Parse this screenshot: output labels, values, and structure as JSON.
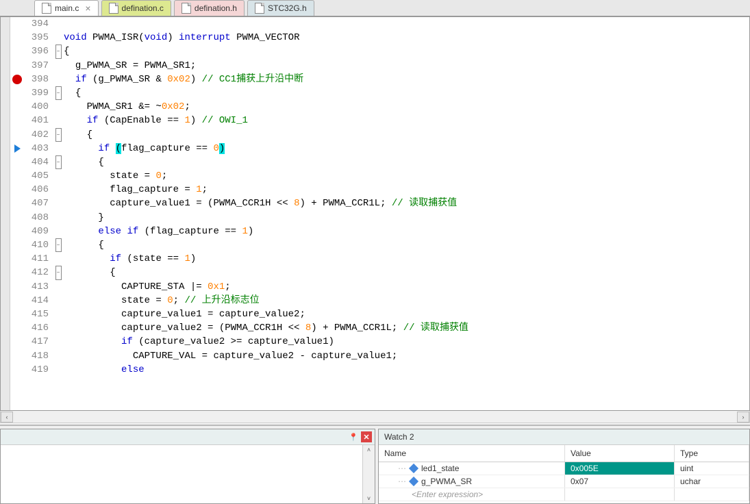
{
  "tabs": [
    {
      "label": "main.c",
      "style": "active",
      "closable": true
    },
    {
      "label": "defination.c",
      "style": "yellow",
      "closable": false
    },
    {
      "label": "defination.h",
      "style": "pink",
      "closable": false
    },
    {
      "label": "STC32G.h",
      "style": "gray",
      "closable": false
    }
  ],
  "line_numbers": [
    "394",
    "395",
    "396",
    "397",
    "398",
    "399",
    "400",
    "401",
    "402",
    "403",
    "404",
    "405",
    "406",
    "407",
    "408",
    "409",
    "410",
    "411",
    "412",
    "413",
    "414",
    "415",
    "416",
    "417",
    "418",
    "419"
  ],
  "markers": {
    "398": "breakpoint",
    "403": "cursor"
  },
  "fold": {
    "396": "minus",
    "399": "minus",
    "402": "minus",
    "404": "minus",
    "410": "minus",
    "412": "minus"
  },
  "code": [
    {
      "indent": 0,
      "parts": [
        {
          "t": "",
          "c": ""
        }
      ]
    },
    {
      "indent": 0,
      "parts": [
        {
          "t": "void",
          "c": "kw"
        },
        {
          "t": " PWMA_ISR(",
          "c": ""
        },
        {
          "t": "void",
          "c": "kw"
        },
        {
          "t": ") ",
          "c": ""
        },
        {
          "t": "interrupt",
          "c": "kw"
        },
        {
          "t": " PWMA_VECTOR",
          "c": ""
        }
      ]
    },
    {
      "indent": 0,
      "parts": [
        {
          "t": "{",
          "c": ""
        }
      ]
    },
    {
      "indent": 1,
      "parts": [
        {
          "t": "g_PWMA_SR = PWMA_SR1;",
          "c": ""
        }
      ]
    },
    {
      "indent": 1,
      "parts": [
        {
          "t": "if",
          "c": "kw"
        },
        {
          "t": " (g_PWMA_SR & ",
          "c": ""
        },
        {
          "t": "0x02",
          "c": "num"
        },
        {
          "t": ") ",
          "c": ""
        },
        {
          "t": "// CC1捕获上升沿中断",
          "c": "com"
        }
      ]
    },
    {
      "indent": 1,
      "parts": [
        {
          "t": "{",
          "c": ""
        }
      ]
    },
    {
      "indent": 2,
      "parts": [
        {
          "t": "PWMA_SR1 &= ~",
          "c": ""
        },
        {
          "t": "0x02",
          "c": "num"
        },
        {
          "t": ";",
          "c": ""
        }
      ]
    },
    {
      "indent": 2,
      "parts": [
        {
          "t": "if",
          "c": "kw"
        },
        {
          "t": " (CapEnable == ",
          "c": ""
        },
        {
          "t": "1",
          "c": "num"
        },
        {
          "t": ") ",
          "c": ""
        },
        {
          "t": "// OWI_1",
          "c": "com"
        }
      ]
    },
    {
      "indent": 2,
      "parts": [
        {
          "t": "{",
          "c": ""
        }
      ]
    },
    {
      "indent": 3,
      "parts": [
        {
          "t": "if",
          "c": "kw"
        },
        {
          "t": " ",
          "c": ""
        },
        {
          "t": "(",
          "c": "hl"
        },
        {
          "t": "flag_capture == ",
          "c": ""
        },
        {
          "t": "0",
          "c": "num"
        },
        {
          "t": ")",
          "c": "hl"
        }
      ]
    },
    {
      "indent": 3,
      "parts": [
        {
          "t": "{",
          "c": ""
        }
      ]
    },
    {
      "indent": 4,
      "parts": [
        {
          "t": "state = ",
          "c": ""
        },
        {
          "t": "0",
          "c": "num"
        },
        {
          "t": ";",
          "c": ""
        }
      ]
    },
    {
      "indent": 4,
      "parts": [
        {
          "t": "flag_capture = ",
          "c": ""
        },
        {
          "t": "1",
          "c": "num"
        },
        {
          "t": ";",
          "c": ""
        }
      ]
    },
    {
      "indent": 4,
      "parts": [
        {
          "t": "capture_value1 = (PWMA_CCR1H << ",
          "c": ""
        },
        {
          "t": "8",
          "c": "num"
        },
        {
          "t": ") + PWMA_CCR1L; ",
          "c": ""
        },
        {
          "t": "// 读取捕获值",
          "c": "com"
        }
      ]
    },
    {
      "indent": 3,
      "parts": [
        {
          "t": "}",
          "c": ""
        }
      ]
    },
    {
      "indent": 3,
      "parts": [
        {
          "t": "else",
          "c": "kw"
        },
        {
          "t": " ",
          "c": ""
        },
        {
          "t": "if",
          "c": "kw"
        },
        {
          "t": " (flag_capture == ",
          "c": ""
        },
        {
          "t": "1",
          "c": "num"
        },
        {
          "t": ")",
          "c": ""
        }
      ]
    },
    {
      "indent": 3,
      "parts": [
        {
          "t": "{",
          "c": ""
        }
      ]
    },
    {
      "indent": 4,
      "parts": [
        {
          "t": "if",
          "c": "kw"
        },
        {
          "t": " (state == ",
          "c": ""
        },
        {
          "t": "1",
          "c": "num"
        },
        {
          "t": ")",
          "c": ""
        }
      ]
    },
    {
      "indent": 4,
      "parts": [
        {
          "t": "{",
          "c": ""
        }
      ]
    },
    {
      "indent": 5,
      "parts": [
        {
          "t": "CAPTURE_STA |= ",
          "c": ""
        },
        {
          "t": "0x1",
          "c": "num"
        },
        {
          "t": ";",
          "c": ""
        }
      ]
    },
    {
      "indent": 5,
      "parts": [
        {
          "t": "state = ",
          "c": ""
        },
        {
          "t": "0",
          "c": "num"
        },
        {
          "t": "; ",
          "c": ""
        },
        {
          "t": "// 上升沿标志位",
          "c": "com"
        }
      ]
    },
    {
      "indent": 5,
      "parts": [
        {
          "t": "capture_value1 = capture_value2;",
          "c": ""
        }
      ]
    },
    {
      "indent": 5,
      "parts": [
        {
          "t": "capture_value2 = (PWMA_CCR1H << ",
          "c": ""
        },
        {
          "t": "8",
          "c": "num"
        },
        {
          "t": ") + PWMA_CCR1L; ",
          "c": ""
        },
        {
          "t": "// 读取捕获值",
          "c": "com"
        }
      ]
    },
    {
      "indent": 5,
      "parts": [
        {
          "t": "if",
          "c": "kw"
        },
        {
          "t": " (capture_value2 >= capture_value1)",
          "c": ""
        }
      ]
    },
    {
      "indent": 6,
      "parts": [
        {
          "t": "CAPTURE_VAL = capture_value2 - capture_value1;",
          "c": ""
        }
      ]
    },
    {
      "indent": 5,
      "parts": [
        {
          "t": "else",
          "c": "kw"
        }
      ]
    }
  ],
  "watch": {
    "title": "Watch 2",
    "headers": {
      "name": "Name",
      "value": "Value",
      "type": "Type"
    },
    "rows": [
      {
        "name": "led1_state",
        "value": "0x005E",
        "type": "uint",
        "highlight": true
      },
      {
        "name": "g_PWMA_SR",
        "value": "0x07",
        "type": "uchar",
        "highlight": false
      }
    ],
    "enter": "<Enter expression>"
  },
  "scroll": {
    "left_arrow": "‹",
    "right_arrow": "›",
    "up_arrow": "˄",
    "down_arrow": "˅"
  },
  "close_symbol": "✕",
  "pin_symbol": "📌",
  "fold_minus": "−"
}
